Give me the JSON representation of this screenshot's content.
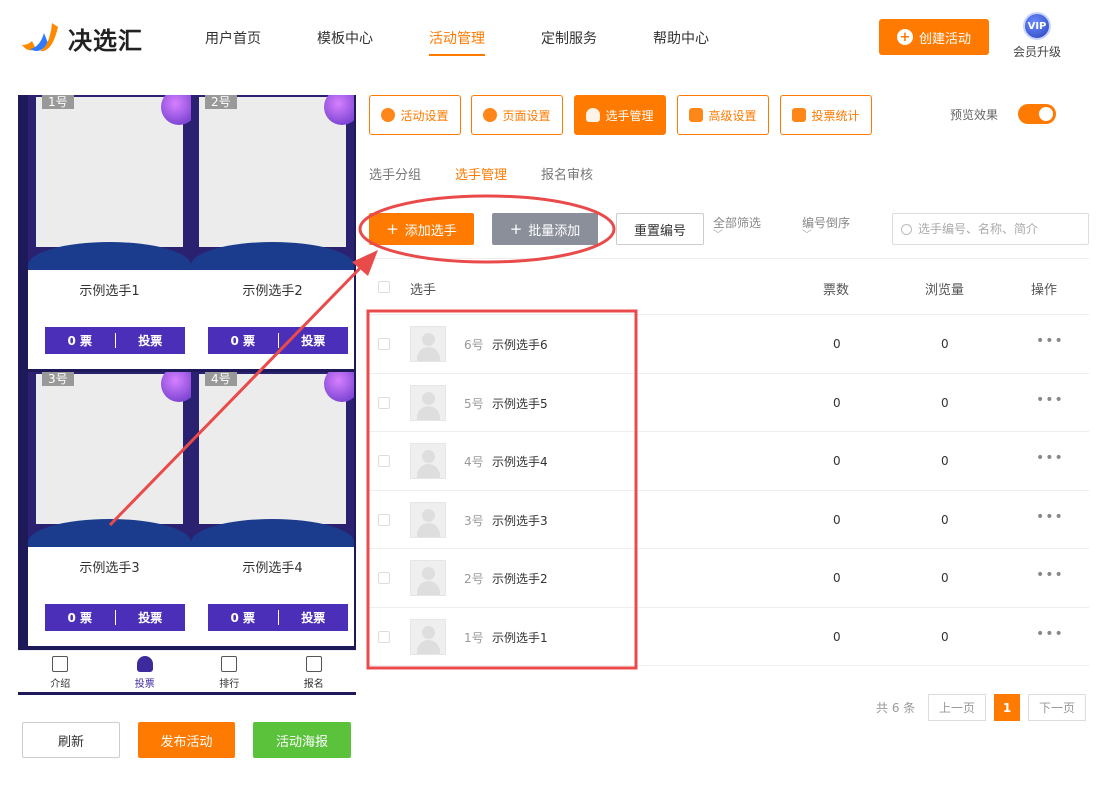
{
  "brand": {
    "name": "决选汇"
  },
  "nav": [
    {
      "label": "用户首页"
    },
    {
      "label": "模板中心"
    },
    {
      "label": "活动管理",
      "active": true
    },
    {
      "label": "定制服务"
    },
    {
      "label": "帮助中心"
    }
  ],
  "header": {
    "create_label": "创建活动",
    "vip_badge": "VIP",
    "vip_label": "会员升级"
  },
  "phone": {
    "cards": [
      {
        "num": "1号",
        "name": "示例选手1",
        "votes": "0 票",
        "vote_btn": "投票"
      },
      {
        "num": "2号",
        "name": "示例选手2",
        "votes": "0 票",
        "vote_btn": "投票"
      },
      {
        "num": "3号",
        "name": "示例选手3",
        "votes": "0 票",
        "vote_btn": "投票"
      },
      {
        "num": "4号",
        "name": "示例选手4",
        "votes": "0 票",
        "vote_btn": "投票"
      }
    ],
    "bottom_nav": [
      {
        "label": "介绍",
        "icon": "intro-icon"
      },
      {
        "label": "投票",
        "icon": "vote-user-icon",
        "active": true
      },
      {
        "label": "排行",
        "icon": "ranking-icon"
      },
      {
        "label": "报名",
        "icon": "signup-icon"
      }
    ]
  },
  "left_actions": {
    "refresh": "刷新",
    "publish": "发布活动",
    "poster": "活动海报"
  },
  "tabs": [
    {
      "label": "活动设置",
      "icon": "star-icon"
    },
    {
      "label": "页面设置",
      "icon": "gear-icon"
    },
    {
      "label": "选手管理",
      "icon": "users-icon",
      "active": true
    },
    {
      "label": "高级设置",
      "icon": "advanced-settings-icon"
    },
    {
      "label": "投票统计",
      "icon": "bar-chart-icon"
    }
  ],
  "preview": {
    "label": "预览效果",
    "on": true
  },
  "subtabs": [
    {
      "label": "选手分组"
    },
    {
      "label": "选手管理",
      "active": true
    },
    {
      "label": "报名审核"
    }
  ],
  "toolbar": {
    "add_label": "添加选手",
    "batch_label": "批量添加",
    "reset_label": "重置编号",
    "filter_all": "全部筛选",
    "sort_label": "编号倒序",
    "search_placeholder": "选手编号、名称、简介"
  },
  "table": {
    "headers": {
      "player": "选手",
      "votes": "票数",
      "views": "浏览量",
      "ops": "操作"
    },
    "rows": [
      {
        "num": "6号",
        "name": "示例选手6",
        "votes": "0",
        "views": "0",
        "ops": "•••"
      },
      {
        "num": "5号",
        "name": "示例选手5",
        "votes": "0",
        "views": "0",
        "ops": "•••"
      },
      {
        "num": "4号",
        "name": "示例选手4",
        "votes": "0",
        "views": "0",
        "ops": "•••"
      },
      {
        "num": "3号",
        "name": "示例选手3",
        "votes": "0",
        "views": "0",
        "ops": "•••"
      },
      {
        "num": "2号",
        "name": "示例选手2",
        "votes": "0",
        "views": "0",
        "ops": "•••"
      },
      {
        "num": "1号",
        "name": "示例选手1",
        "votes": "0",
        "views": "0",
        "ops": "•••"
      }
    ]
  },
  "pager": {
    "total": "共 6 条",
    "prev": "上一页",
    "current": "1",
    "next": "下一页"
  },
  "colors": {
    "accent": "#ff7a00",
    "annotation": "#e94b4b",
    "phone_bg": "#1e1a5a",
    "vote_btn": "#4b2fb8",
    "poster_btn": "#5bc23c"
  }
}
